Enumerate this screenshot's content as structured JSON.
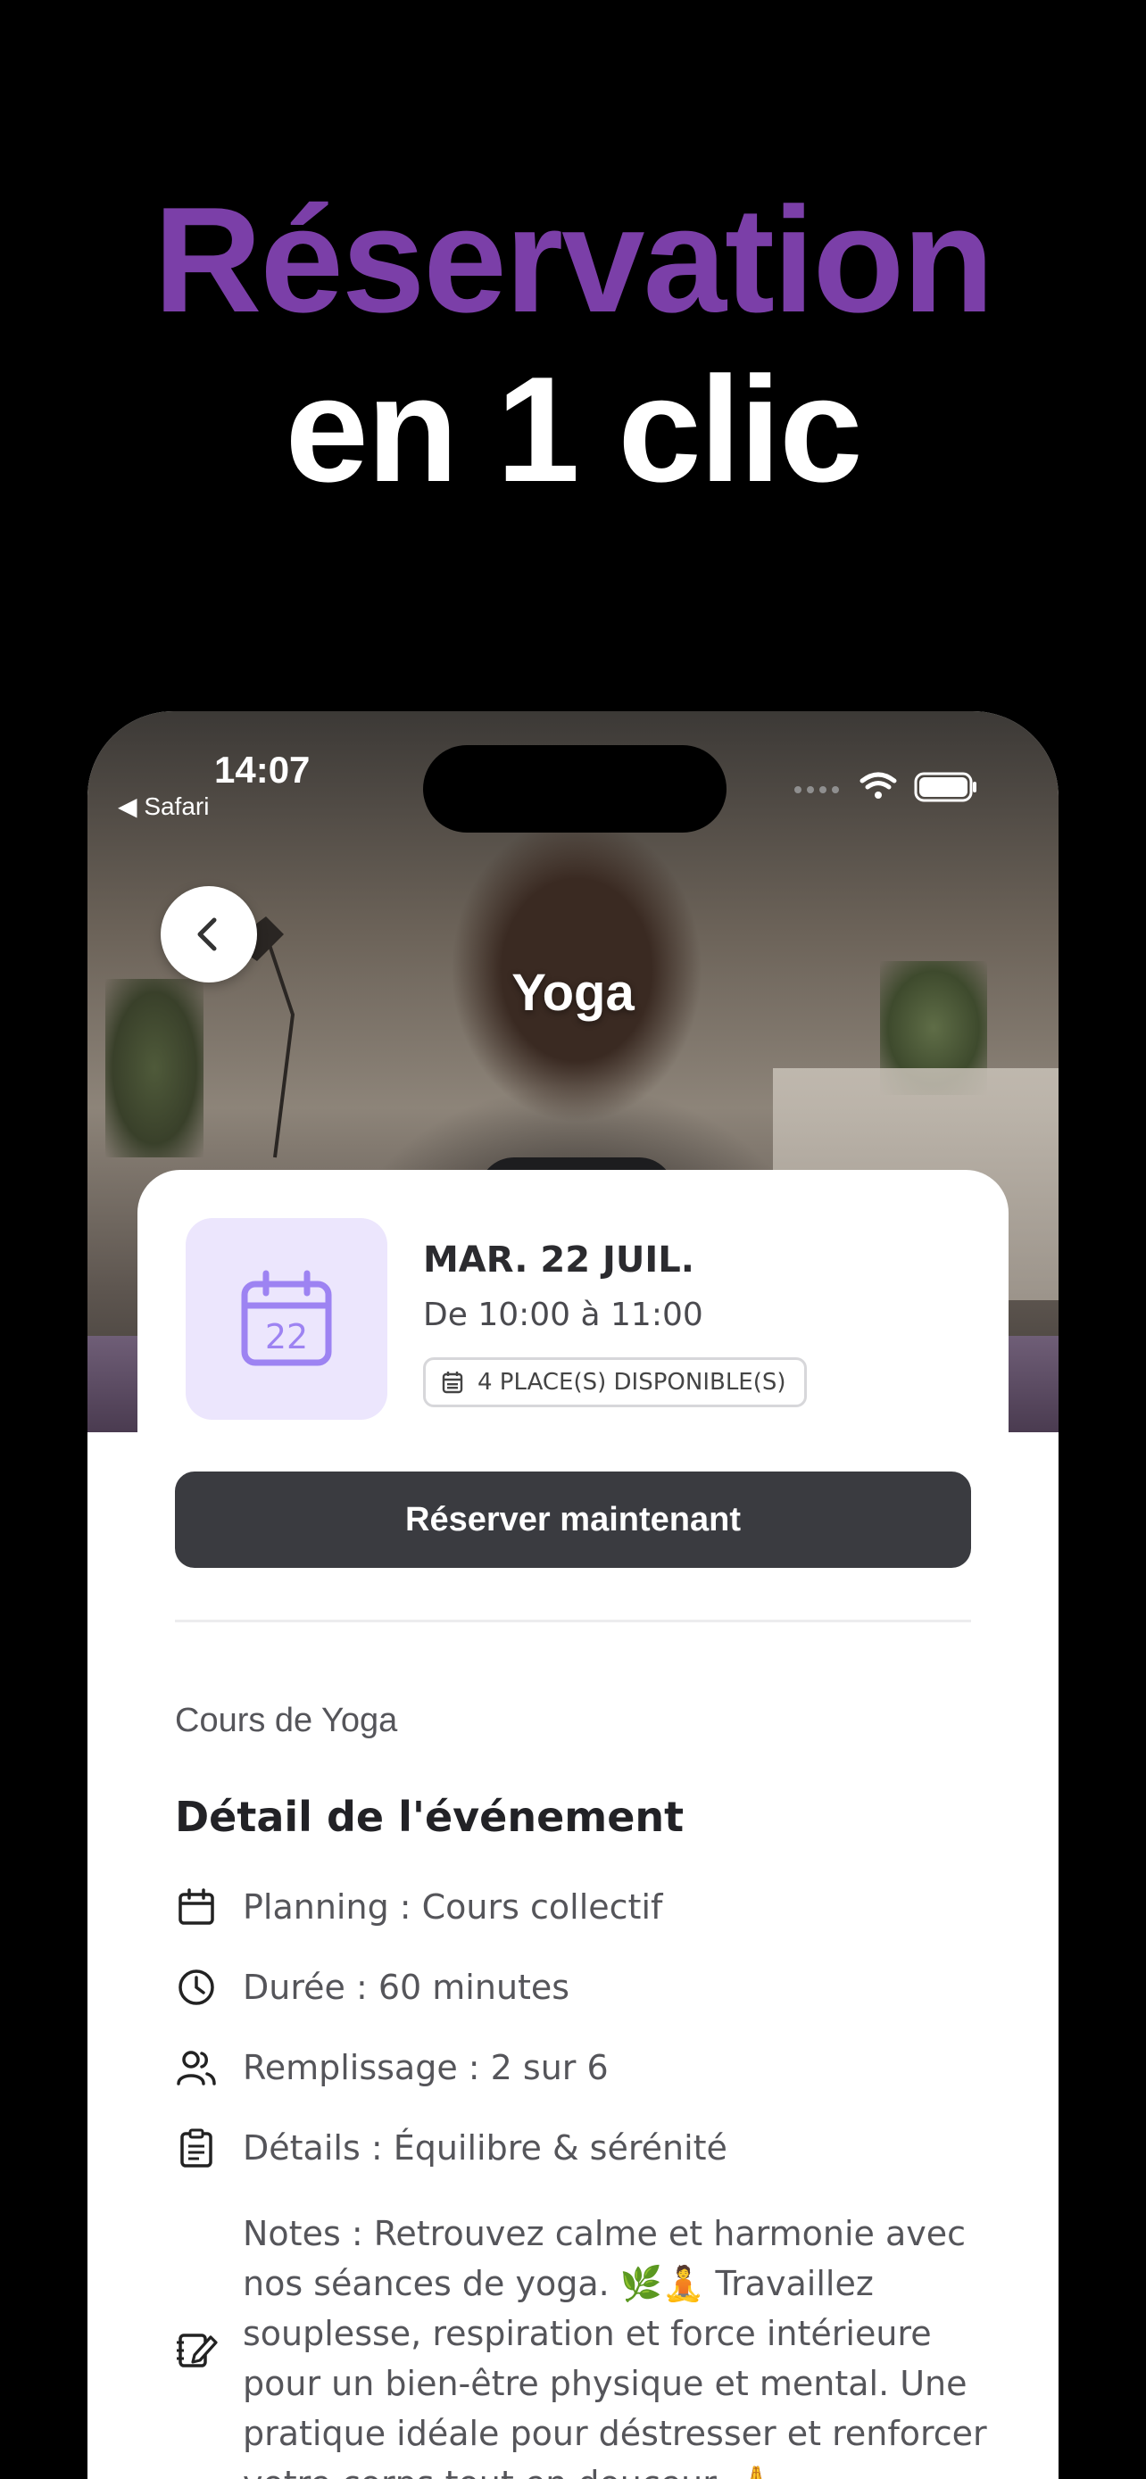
{
  "headline": {
    "line1": "Réservation",
    "line2": "en 1 clic"
  },
  "status_bar": {
    "time": "14:07",
    "back_app": "◀ Safari"
  },
  "hero": {
    "title": "Yoga"
  },
  "event": {
    "date": "MAR. 22 JUIL.",
    "time_range": "De 10:00 à 11:00",
    "calendar_day": "22",
    "places_badge": "4 PLACE(S) DISPONIBLE(S)"
  },
  "reserve_button": "Réserver maintenant",
  "course_name": "Cours de Yoga",
  "details": {
    "title": "Détail de l'événement",
    "planning": "Planning : Cours collectif",
    "duration": "Durée : 60 minutes",
    "filling": "Remplissage : 2 sur 6",
    "details": "Détails : Équilibre & sérénité",
    "notes": "Notes : Retrouvez calme et harmonie avec nos séances de yoga. 🌿🧘 Travaillez souplesse, respiration et force intérieure pour un bien-être physique et mental. Une pratique idéale pour déstresser et renforcer votre corps tout en douceur. 🙏"
  },
  "colors": {
    "accent": "#7b3fa8",
    "calendar_tile": "#ece6fd",
    "button": "#3a3b40"
  }
}
